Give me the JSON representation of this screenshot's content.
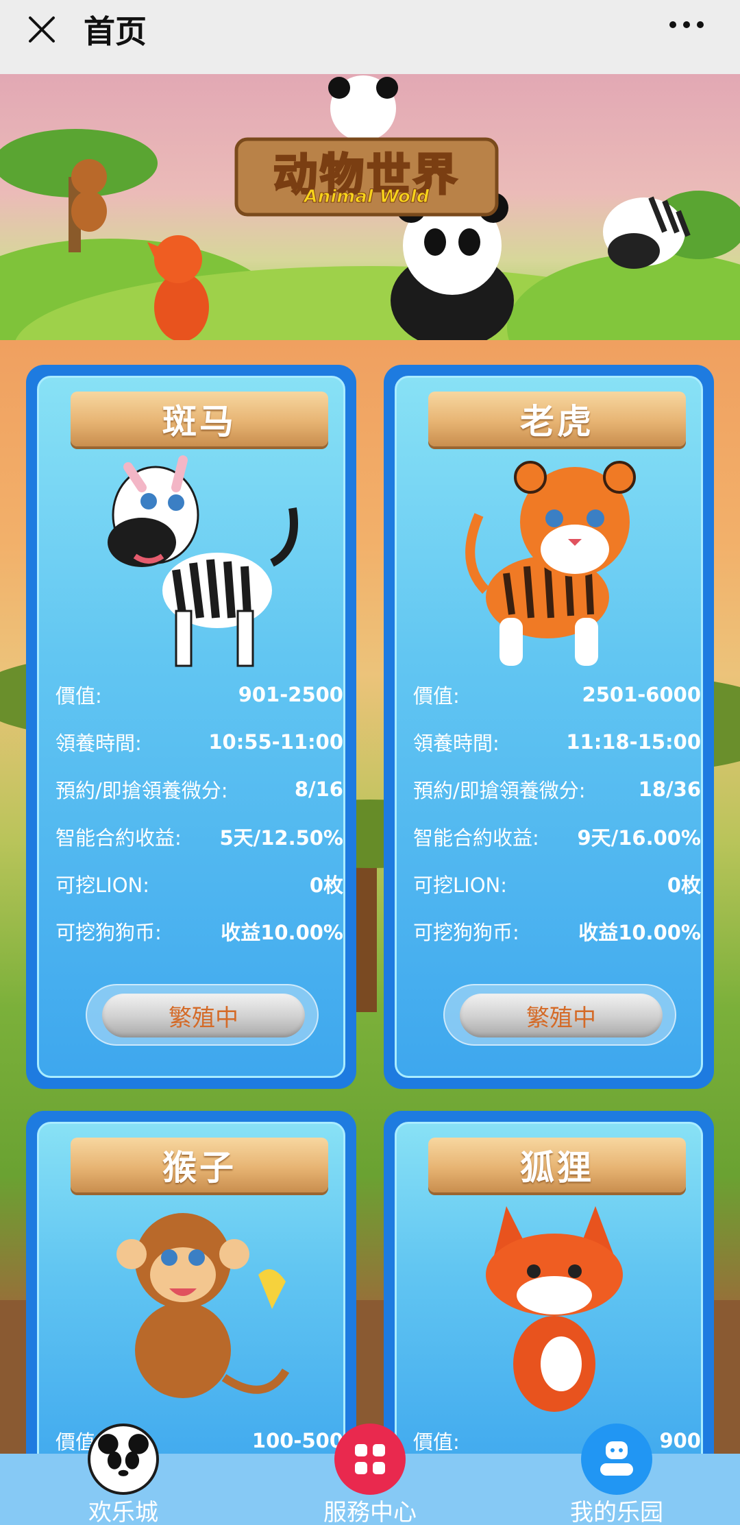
{
  "topbar": {
    "title": "首页"
  },
  "banner": {
    "logo_cn": "动物世界",
    "logo_en": "Animal Wold"
  },
  "labels": {
    "value": "價值:",
    "adopt_time": "領養時間:",
    "reserve": "預約/即搶領養微分:",
    "contract": "智能合約收益:",
    "lion": "可挖LION:",
    "dog": "可挖狗狗币:"
  },
  "cards": [
    {
      "name": "斑马",
      "value": "901-2500",
      "adopt_time": "10:55-11:00",
      "reserve": "8/16",
      "contract": "5天/12.50%",
      "lion": "0枚",
      "dog": "收益10.00%",
      "status": "繁殖中"
    },
    {
      "name": "老虎",
      "value": "2501-6000",
      "adopt_time": "11:18-15:00",
      "reserve": "18/36",
      "contract": "9天/16.00%",
      "lion": "0枚",
      "dog": "收益10.00%",
      "status": "繁殖中"
    },
    {
      "name": "猴子",
      "value": "100-500"
    },
    {
      "name": "狐狸",
      "value": "900"
    }
  ],
  "nav": [
    {
      "label": "欢乐城",
      "icon": "panda-icon"
    },
    {
      "label": "服務中心",
      "icon": "grid-icon"
    },
    {
      "label": "我的乐园",
      "icon": "user-icon"
    }
  ],
  "colors": {
    "card_border": "#1e7be0",
    "card_fill": "#62c6f2",
    "status_text": "#d46a27",
    "nav_bg": "#86c9f5",
    "nav_service": "#e9294e",
    "nav_mine": "#2196f3"
  }
}
